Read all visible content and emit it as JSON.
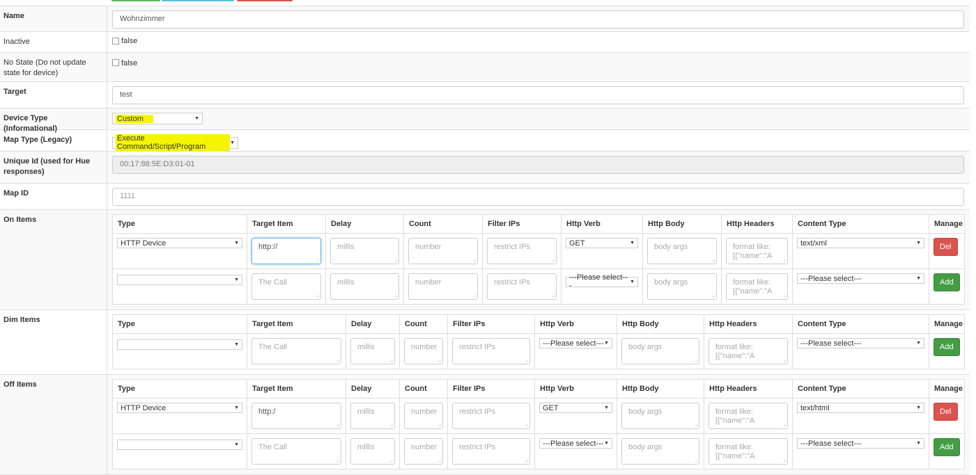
{
  "colors": {
    "highlight": "#f5f500",
    "del": "#d9534f",
    "add": "#449d44"
  },
  "fields": {
    "name": {
      "label": "Name",
      "value": "Wohnzimmer"
    },
    "inactive": {
      "label": "Inactive",
      "value": "false"
    },
    "nostate": {
      "label": "No State (Do not update state for device)",
      "value": "false"
    },
    "target": {
      "label": "Target",
      "value": "test"
    },
    "devicetype": {
      "label": "Device Type (Informational)",
      "value": "Custom"
    },
    "maptype": {
      "label": "Map Type (Legacy)",
      "value": "Execute Command/Script/Program"
    },
    "uniqueid": {
      "label": "Unique Id (used for Hue responses)",
      "value": "00:17:88:5E:D3:01-01"
    },
    "mapid": {
      "label": "Map ID",
      "value": "1111"
    }
  },
  "headers": [
    "Type",
    "Target Item",
    "Delay",
    "Count",
    "Filter IPs",
    "Http Verb",
    "Http Body",
    "Http Headers",
    "Content Type",
    "Manage"
  ],
  "sections": [
    {
      "label": "On Items",
      "rows": [
        {
          "type": "HTTP Device",
          "target": "http://",
          "target_filled": true,
          "delay": "millis",
          "count": "number",
          "filter": "restrict IPs",
          "verb": "GET",
          "body": "body args",
          "headers": "format like: [{\"name\":\"A",
          "content": "text/xml",
          "action": "Del"
        },
        {
          "type": "",
          "target": "The Call",
          "target_filled": false,
          "delay": "millis",
          "count": "number",
          "filter": "restrict IPs",
          "verb": "---Please select---",
          "body": "body args",
          "headers": "format like: [{\"name\":\"A",
          "content": "---Please select---",
          "action": "Add"
        }
      ]
    },
    {
      "label": "Dim Items",
      "rows": [
        {
          "type": "",
          "target": "The Call",
          "target_filled": false,
          "delay": "millis",
          "count": "number",
          "filter": "restrict IPs",
          "verb": "---Please select---",
          "body": "body args",
          "headers": "format like: [{\"name\":\"A",
          "content": "---Please select---",
          "action": "Add"
        }
      ]
    },
    {
      "label": "Off Items",
      "rows": [
        {
          "type": "HTTP Device",
          "target": "http:/",
          "target_filled": true,
          "delay": "millis",
          "count": "number",
          "filter": "restrict IPs",
          "verb": "GET",
          "body": "body args",
          "headers": "format like: [{\"name\":\"A",
          "content": "text/html",
          "action": "Del"
        },
        {
          "type": "",
          "target": "The Call",
          "target_filled": false,
          "delay": "millis",
          "count": "number",
          "filter": "restrict IPs",
          "verb": "---Please select---",
          "body": "body args",
          "headers": "format like: [{\"name\":\"A",
          "content": "---Please select---",
          "action": "Add"
        }
      ]
    }
  ]
}
